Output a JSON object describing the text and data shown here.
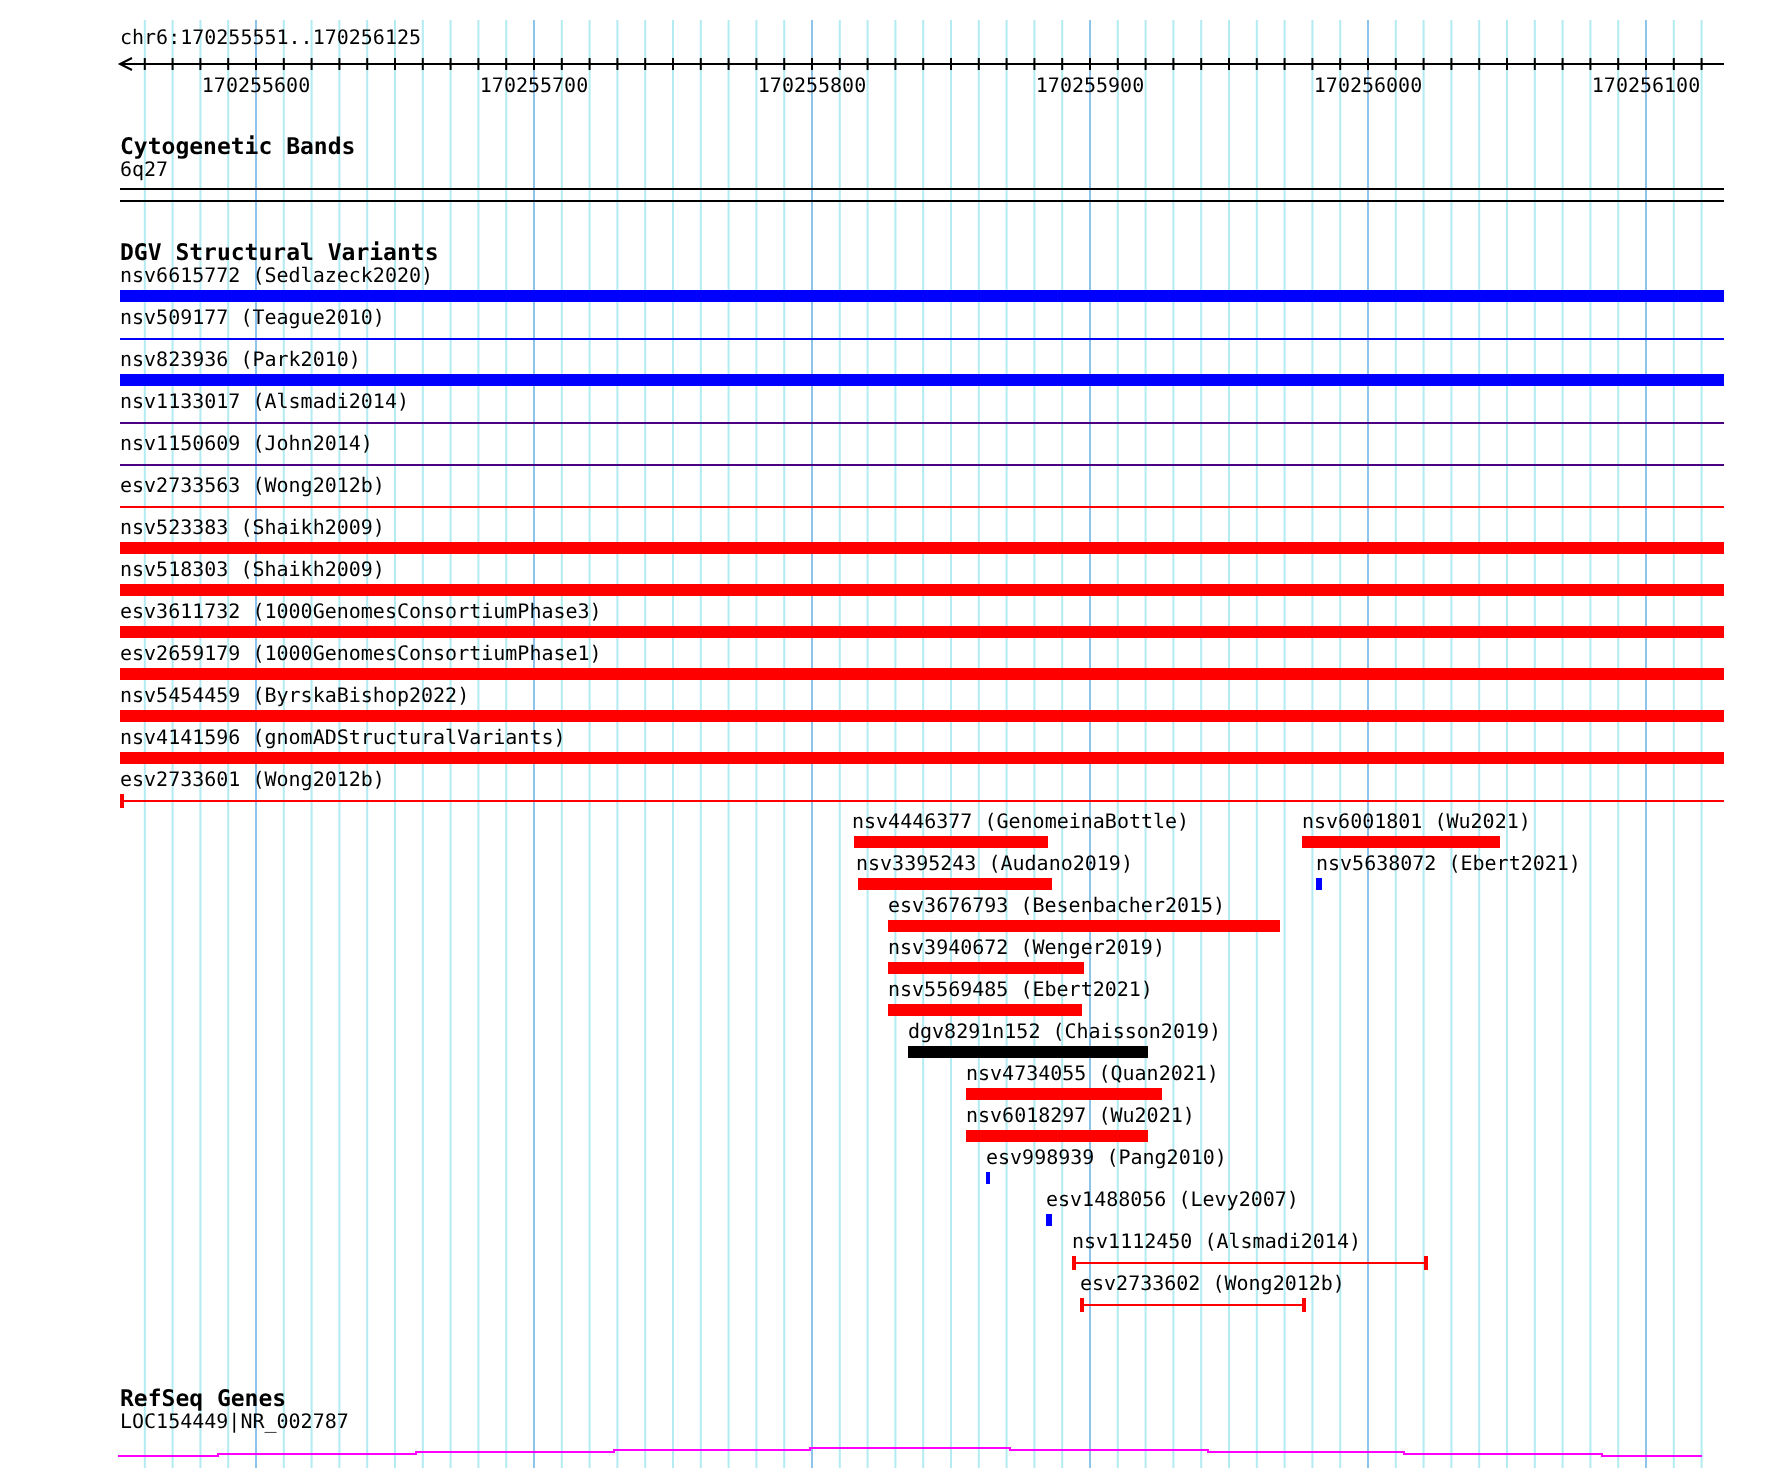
{
  "ruler": {
    "location": "chr6:170255551..170256125",
    "ticks": [
      "170255600",
      "170255700",
      "170255800",
      "170255900",
      "170256000",
      "170256100"
    ]
  },
  "bands": {
    "title": "Cytogenetic Bands",
    "label": "6q27"
  },
  "variants": {
    "title": "DGV Structural Variants",
    "rows": [
      {
        "name": "nsv6615772 (Sedlazeck2020)",
        "kind": "thick",
        "color": "#0000ff"
      },
      {
        "name": "nsv509177 (Teague2010)",
        "kind": "thin",
        "color": "#0000ff"
      },
      {
        "name": "nsv823936 (Park2010)",
        "kind": "thick",
        "color": "#0000ff"
      },
      {
        "name": "nsv1133017 (Alsmadi2014)",
        "kind": "thin",
        "color": "#4b0082"
      },
      {
        "name": "nsv1150609 (John2014)",
        "kind": "thin",
        "color": "#4b0082"
      },
      {
        "name": "esv2733563 (Wong2012b)",
        "kind": "thin",
        "color": "#ff0000"
      },
      {
        "name": "nsv523383 (Shaikh2009)",
        "kind": "thick",
        "color": "#ff0000"
      },
      {
        "name": "nsv518303 (Shaikh2009)",
        "kind": "thick",
        "color": "#ff0000"
      },
      {
        "name": "esv3611732 (1000GenomesConsortiumPhase3)",
        "kind": "thick",
        "color": "#ff0000"
      },
      {
        "name": "esv2659179 (1000GenomesConsortiumPhase1)",
        "kind": "thick",
        "color": "#ff0000"
      },
      {
        "name": "nsv5454459 (ByrskaBishop2022)",
        "kind": "thick",
        "color": "#ff0000"
      },
      {
        "name": "nsv4141596 (gnomADStructuralVariants)",
        "kind": "thick",
        "color": "#ff0000"
      },
      {
        "name": "esv2733601 (Wong2012b)",
        "kind": "span",
        "color": "#ff0000"
      }
    ],
    "features": [
      {
        "name": "nsv4446377 (GenomeinaBottle)",
        "kind": "thick",
        "color": "#ff0000"
      },
      {
        "name": "nsv6001801 (Wu2021)",
        "kind": "thick",
        "color": "#ff0000"
      },
      {
        "name": "nsv3395243 (Audano2019)",
        "kind": "thick",
        "color": "#ff0000"
      },
      {
        "name": "nsv5638072 (Ebert2021)",
        "kind": "thick",
        "color": "#0000ff"
      },
      {
        "name": "esv3676793 (Besenbacher2015)",
        "kind": "thick",
        "color": "#ff0000"
      },
      {
        "name": "nsv3940672 (Wenger2019)",
        "kind": "thick",
        "color": "#ff0000"
      },
      {
        "name": "nsv5569485 (Ebert2021)",
        "kind": "thick",
        "color": "#ff0000"
      },
      {
        "name": "dgv8291n152 (Chaisson2019)",
        "kind": "thick",
        "color": "#000000"
      },
      {
        "name": "nsv4734055 (Quan2021)",
        "kind": "thick",
        "color": "#ff0000"
      },
      {
        "name": "nsv6018297 (Wu2021)",
        "kind": "thick",
        "color": "#ff0000"
      },
      {
        "name": "esv998939 (Pang2010)",
        "kind": "thick",
        "color": "#0000ff"
      },
      {
        "name": "esv1488056 (Levy2007)",
        "kind": "thick",
        "color": "#0000ff"
      },
      {
        "name": "nsv1112450 (Alsmadi2014)",
        "kind": "span",
        "color": "#ff0000"
      },
      {
        "name": "esv2733602 (Wong2012b)",
        "kind": "span",
        "color": "#ff0000"
      }
    ]
  },
  "genes": {
    "title": "RefSeq Genes",
    "label": "LOC154449|NR_002787"
  }
}
